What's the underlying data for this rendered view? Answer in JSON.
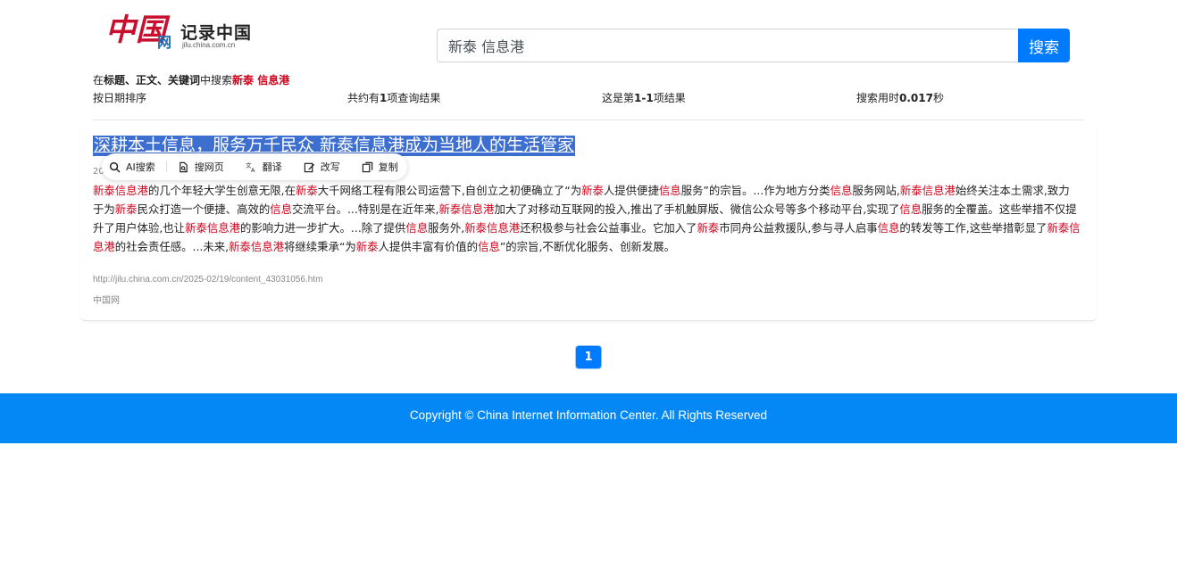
{
  "header": {
    "logo_cn": "中国",
    "logo_net": "网",
    "logo_jl": "记录中国",
    "logo_url": "jilu.china.com.cn",
    "search_value": "新泰 信息港",
    "search_button": "搜索"
  },
  "info": {
    "scope_prefix": "在",
    "scope_fields": "标题、正文、关键词",
    "scope_mid": "中搜索",
    "scope_keyword": "新泰 信息港",
    "sort_label": "按日期排序",
    "total_prefix": "共约有",
    "total_count": "1",
    "total_suffix": "项查询结果",
    "page_prefix": "这是第",
    "page_range": "1-1",
    "page_suffix": "项结果",
    "time_prefix": "搜索用时",
    "time_value": "0.017",
    "time_suffix": "秒"
  },
  "toolbar": {
    "ai_search": "AI搜索",
    "search_page": "搜网页",
    "translate": "翻译",
    "rewrite": "改写",
    "copy": "复制"
  },
  "result": {
    "title": "深耕本土信息，服务万千民众 新泰信息港成为当地人的生活管家",
    "date_stub": "20",
    "snippet": [
      {
        "t": "新泰信息港",
        "h": true
      },
      {
        "t": "的几个年轻大学生创意无限,在",
        "h": false
      },
      {
        "t": "新泰",
        "h": true
      },
      {
        "t": "大千网络工程有限公司运营下,自创立之初便确立了“为",
        "h": false
      },
      {
        "t": "新泰",
        "h": true
      },
      {
        "t": "人提供便捷",
        "h": false
      },
      {
        "t": "信息",
        "h": true
      },
      {
        "t": "服务”的宗旨。...作为地方分类",
        "h": false
      },
      {
        "t": "信息",
        "h": true
      },
      {
        "t": "服务网站,",
        "h": false
      },
      {
        "t": "新泰信息港",
        "h": true
      },
      {
        "t": "始终关注本土需求,致力于为",
        "h": false
      },
      {
        "t": "新泰",
        "h": true
      },
      {
        "t": "民众打造一个便捷、高效的",
        "h": false
      },
      {
        "t": "信息",
        "h": true
      },
      {
        "t": "交流平台。...特别是在近年来,",
        "h": false
      },
      {
        "t": "新泰信息港",
        "h": true
      },
      {
        "t": "加大了对移动互联网的投入,推出了手机触屏版、微信公众号等多个移动平台,实现了",
        "h": false
      },
      {
        "t": "信息",
        "h": true
      },
      {
        "t": "服务的全覆盖。这些举措不仅提升了用户体验,也让",
        "h": false
      },
      {
        "t": "新泰信息港",
        "h": true
      },
      {
        "t": "的影响力进一步扩大。...除了提供",
        "h": false
      },
      {
        "t": "信息",
        "h": true
      },
      {
        "t": "服务外,",
        "h": false
      },
      {
        "t": "新泰信息港",
        "h": true
      },
      {
        "t": "还积极参与社会公益事业。它加入了",
        "h": false
      },
      {
        "t": "新泰",
        "h": true
      },
      {
        "t": "市同舟公益救援队,参与寻人启事",
        "h": false
      },
      {
        "t": "信息",
        "h": true
      },
      {
        "t": "的转发等工作,这些举措彰显了",
        "h": false
      },
      {
        "t": "新泰信息港",
        "h": true
      },
      {
        "t": "的社会责任感。...未来,",
        "h": false
      },
      {
        "t": "新泰信息港",
        "h": true
      },
      {
        "t": "将继续秉承“为",
        "h": false
      },
      {
        "t": "新泰",
        "h": true
      },
      {
        "t": "人提供丰富有价值的",
        "h": false
      },
      {
        "t": "信息",
        "h": true
      },
      {
        "t": "”的宗旨,不断优化服务、创新发展。",
        "h": false
      }
    ],
    "url": "http://jilu.china.com.cn/2025-02/19/content_43031056.htm",
    "source": "中国网"
  },
  "pagination": {
    "current_page": "1"
  },
  "footer": {
    "copyright": "Copyright © China Internet Information Center. All Rights Reserved"
  }
}
